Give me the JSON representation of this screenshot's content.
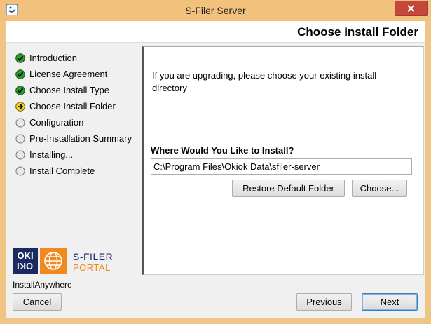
{
  "window": {
    "title": "S-Filer Server"
  },
  "header": {
    "title": "Choose Install Folder"
  },
  "steps": [
    {
      "label": "Introduction",
      "status": "done"
    },
    {
      "label": "License Agreement",
      "status": "done"
    },
    {
      "label": "Choose Install Type",
      "status": "done"
    },
    {
      "label": "Choose Install Folder",
      "status": "current"
    },
    {
      "label": "Configuration",
      "status": "pending"
    },
    {
      "label": "Pre-Installation Summary",
      "status": "pending"
    },
    {
      "label": "Installing...",
      "status": "pending"
    },
    {
      "label": "Install Complete",
      "status": "pending"
    }
  ],
  "branding": {
    "logo_text": "OKI OKI",
    "product_line1": "S-FILER",
    "product_line2": "PORTAL",
    "vendor": "InstallAnywhere"
  },
  "content": {
    "instructions": "If you are upgrading, please choose your existing install directory",
    "question": "Where Would You Like to Install?",
    "path_value": "C:\\Program Files\\Okiok Data\\sfiler-server",
    "restore_label": "Restore Default Folder",
    "choose_label": "Choose..."
  },
  "footer": {
    "cancel_label": "Cancel",
    "previous_label": "Previous",
    "next_label": "Next"
  },
  "colors": {
    "frame": "#f0c584",
    "close": "#c7463b",
    "done": "#2e9a2e",
    "current": "#f2d21f"
  }
}
